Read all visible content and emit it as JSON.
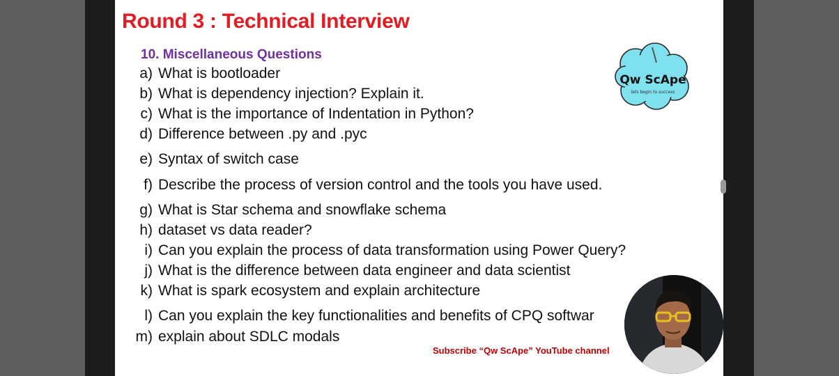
{
  "slide": {
    "title": "Round 3 :  Technical Interview",
    "section": "10. Miscellaneous Questions",
    "questions": [
      {
        "letter": "a)",
        "text": "What is bootloader"
      },
      {
        "letter": "b)",
        "text": "What is dependency injection? Explain it."
      },
      {
        "letter": "c)",
        "text": "What is the importance of Indentation in Python?"
      },
      {
        "letter": "d)",
        "text": "Difference between .py and .pyc"
      },
      {
        "letter": "e)",
        "text": "Syntax of switch case"
      },
      {
        "letter": "f)",
        "text": "Describe the process of version control and the tools you have used."
      },
      {
        "letter": "g)",
        "text": "What is Star schema and snowflake schema"
      },
      {
        "letter": "h)",
        "text": "dataset vs data reader?"
      },
      {
        "letter": "i)",
        "text": "Can you explain the process of data transformation using Power Query?"
      },
      {
        "letter": "j)",
        "text": "What is the difference between data engineer and data scientist"
      },
      {
        "letter": "k)",
        "text": "What is spark ecosystem and explain architecture"
      },
      {
        "letter": "l)",
        "text": "Can you explain the key functionalities and benefits of CPQ softwar"
      },
      {
        "letter": "m)",
        "text": "explain about SDLC modals"
      }
    ],
    "subscribe_text": "Subscribe “Qw ScApe” YouTube channel"
  },
  "logo": {
    "name": "Qw ScApe",
    "tagline": "lets begin to success"
  },
  "colors": {
    "title": "#e31b23",
    "section": "#7030a0",
    "subscribe": "#c00000",
    "logo_cloud": "#7fe0f0",
    "side_bars": "#5e5e5e"
  }
}
